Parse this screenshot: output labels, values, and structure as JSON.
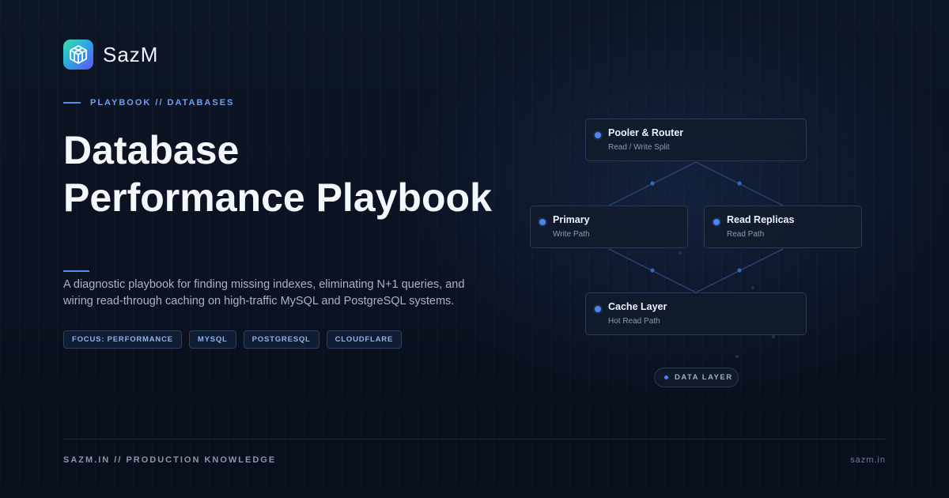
{
  "brand": {
    "name": "SazM",
    "logo_icon": "cube-logo-icon"
  },
  "eyebrow": "PLAYBOOK // DATABASES",
  "title": {
    "line1": "Database",
    "line2": "Performance Playbook"
  },
  "description": "A diagnostic playbook for finding missing indexes, eliminating N+1 queries, and wiring read-through caching on high-traffic MySQL and PostgreSQL systems.",
  "tags": [
    "FOCUS: PERFORMANCE",
    "MYSQL",
    "POSTGRESQL",
    "CLOUDFLARE"
  ],
  "diagram": {
    "nodes": [
      {
        "title": "Pooler & Router",
        "subtitle": "Read / Write Split"
      },
      {
        "title": "Primary",
        "subtitle": "Write Path"
      },
      {
        "title": "Read Replicas",
        "subtitle": "Read Path"
      },
      {
        "title": "Cache Layer",
        "subtitle": "Hot Read Path"
      }
    ],
    "label": "DATA LAYER"
  },
  "footer": {
    "left": "SAZM.IN // PRODUCTION KNOWLEDGE",
    "right": "sazm.in"
  },
  "colors": {
    "accent": "#4f8df0",
    "background": "#0b1220",
    "logo_gradient": [
      "#36e0a8",
      "#2aa5e6",
      "#6b4df0"
    ]
  }
}
